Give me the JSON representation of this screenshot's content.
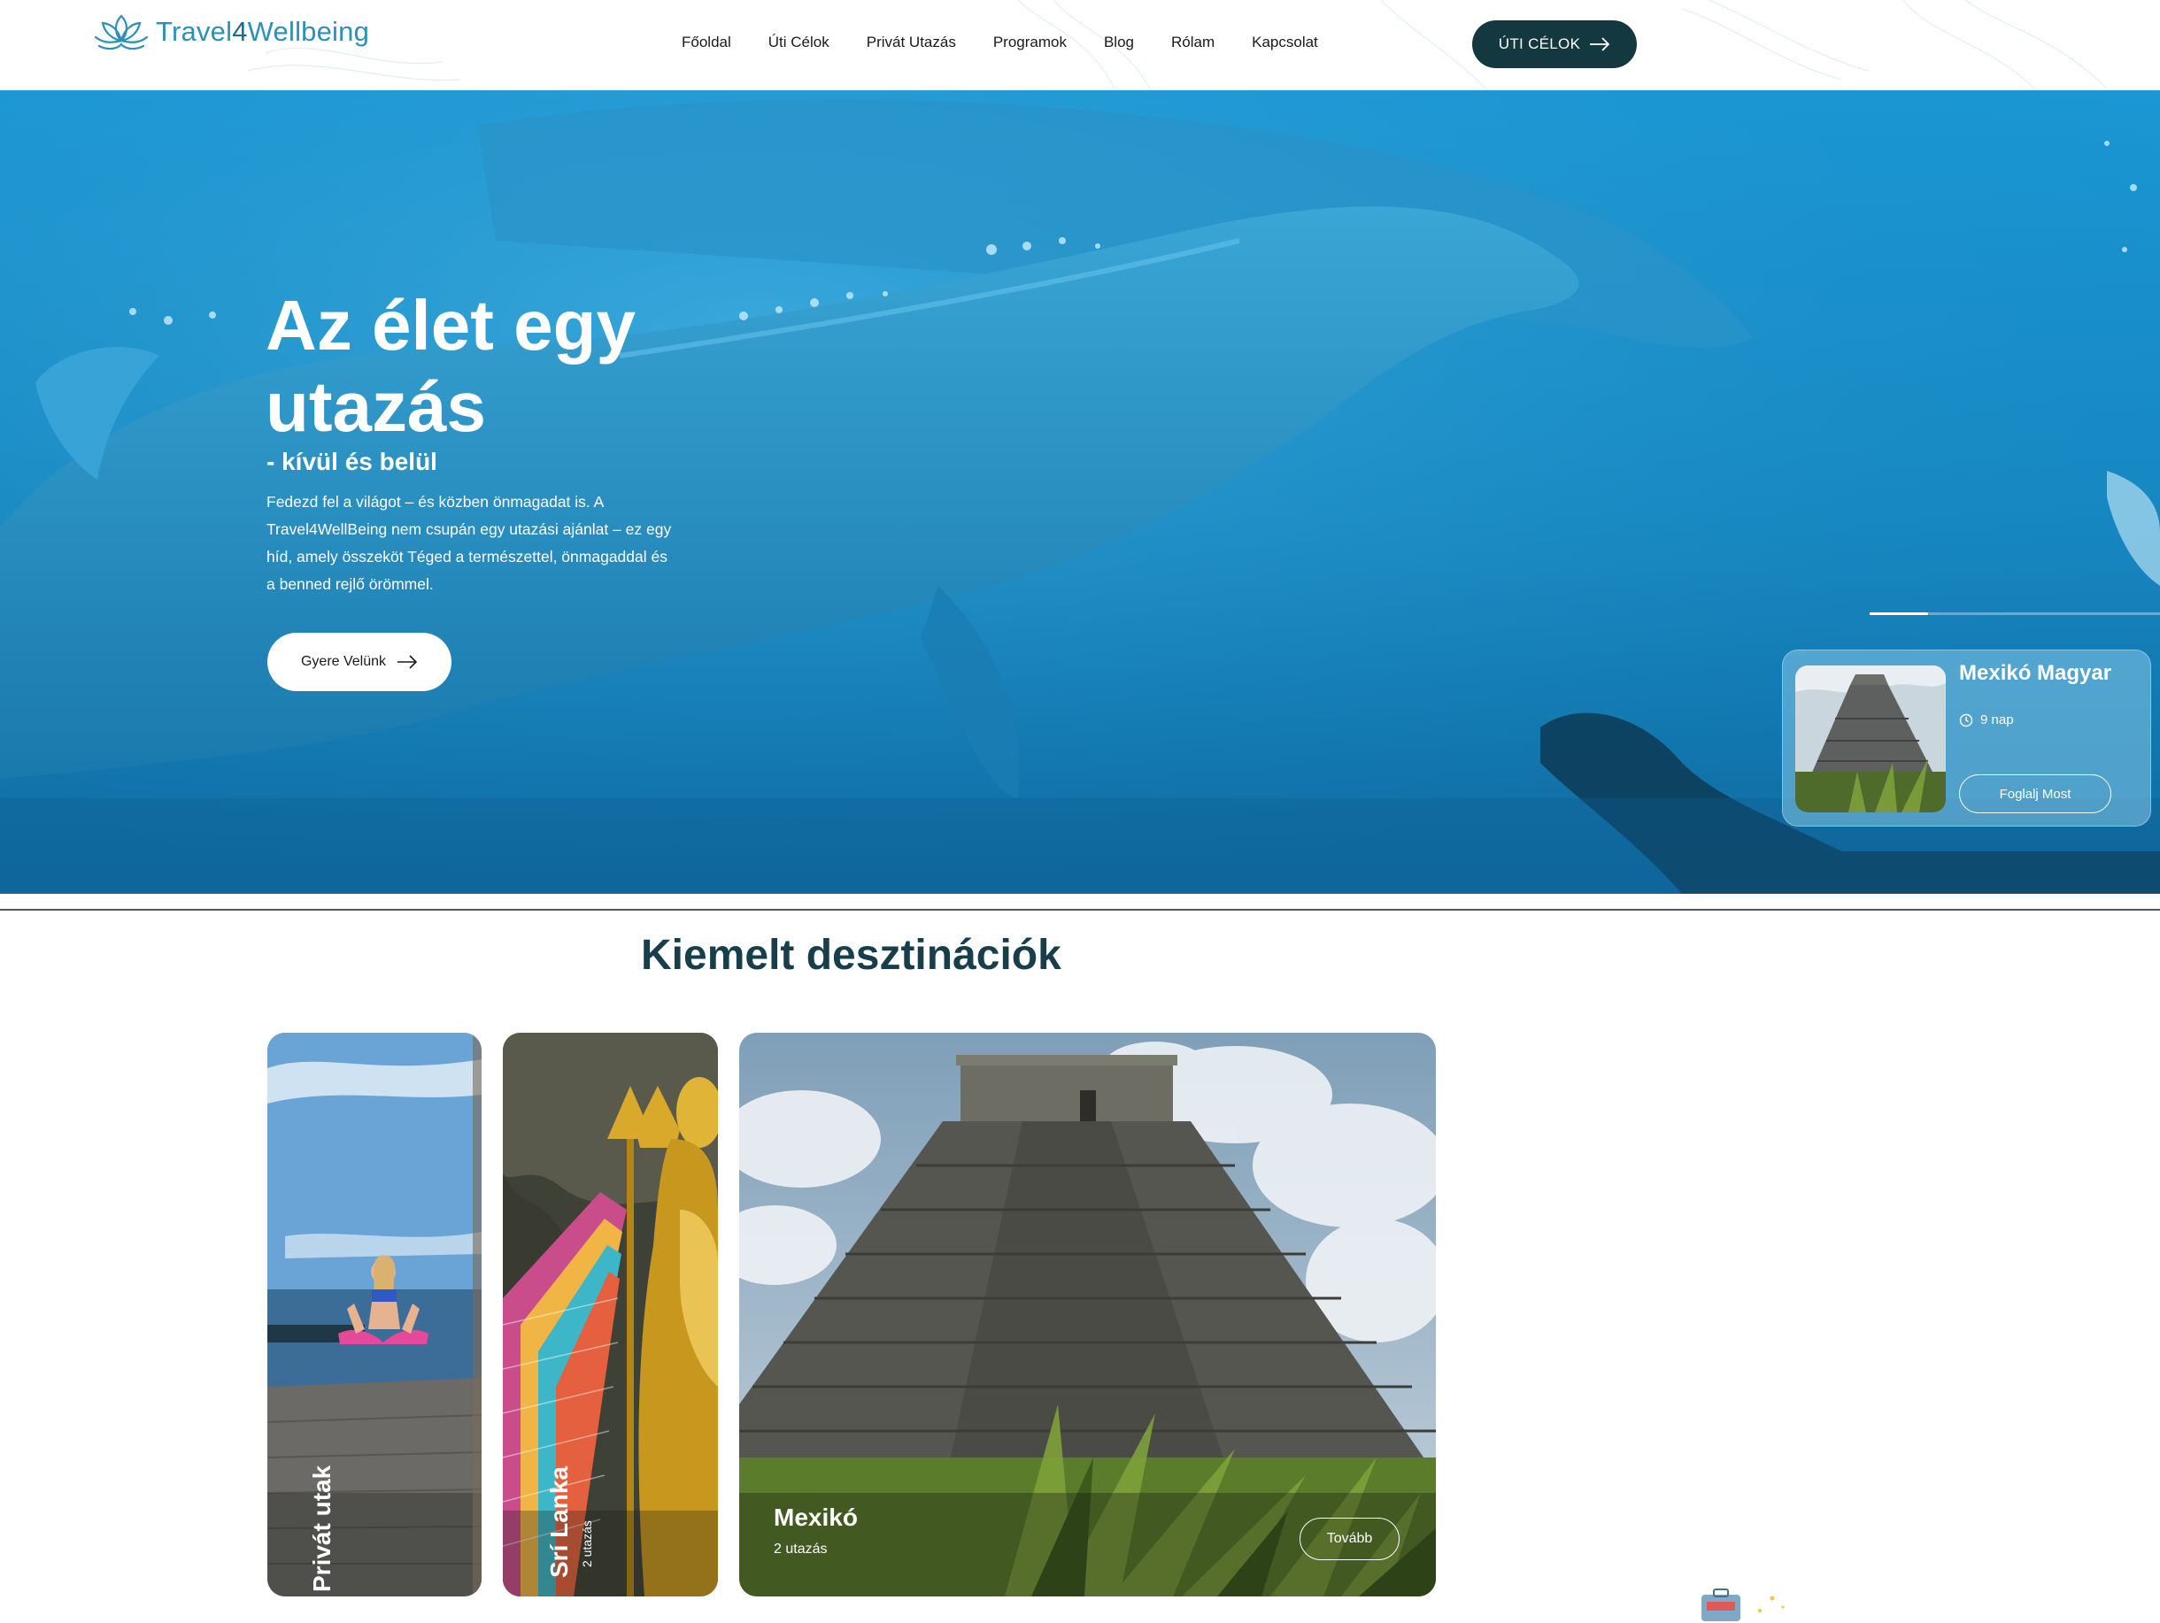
{
  "header": {
    "logo_main": "Travel",
    "logo_accent": "4",
    "logo_tail": "Wellbeing",
    "nav": [
      "Főoldal",
      "Úti Célok",
      "Privát Utazás",
      "Programok",
      "Blog",
      "Rólam",
      "Kapcsolat"
    ],
    "cta_label": "ÚTI CÉLOK"
  },
  "hero": {
    "title": "Az élet egy utazás",
    "subtitle": "- kívül és belül",
    "text": "Fedezd fel a világot – és közben önmagadat is.  A Travel4WellBeing nem csupán egy utazási ajánlat –  ez egy híd, amely összeköt Téged a természettel, önmagaddal és a benned rejlő örömmel.",
    "button_label": "Gyere Velünk",
    "slider_progress": 0.2
  },
  "tour_card": {
    "title": "Mexikó Magyar",
    "duration": "9 nap",
    "button_label": "Foglalj Most"
  },
  "featured": {
    "title": "Kiemelt desztinációk",
    "cards": [
      {
        "label": "Privát utak"
      },
      {
        "label": "Srí Lanka",
        "count": "2 utazás"
      },
      {
        "label": "Mexikó",
        "count": "2 utazás",
        "button_label": "Tovább"
      }
    ]
  },
  "colors": {
    "brand_dark": "#133840",
    "heading": "#173e4a",
    "logo": "#2d90b8",
    "hero_water": "#1b8fc7"
  }
}
